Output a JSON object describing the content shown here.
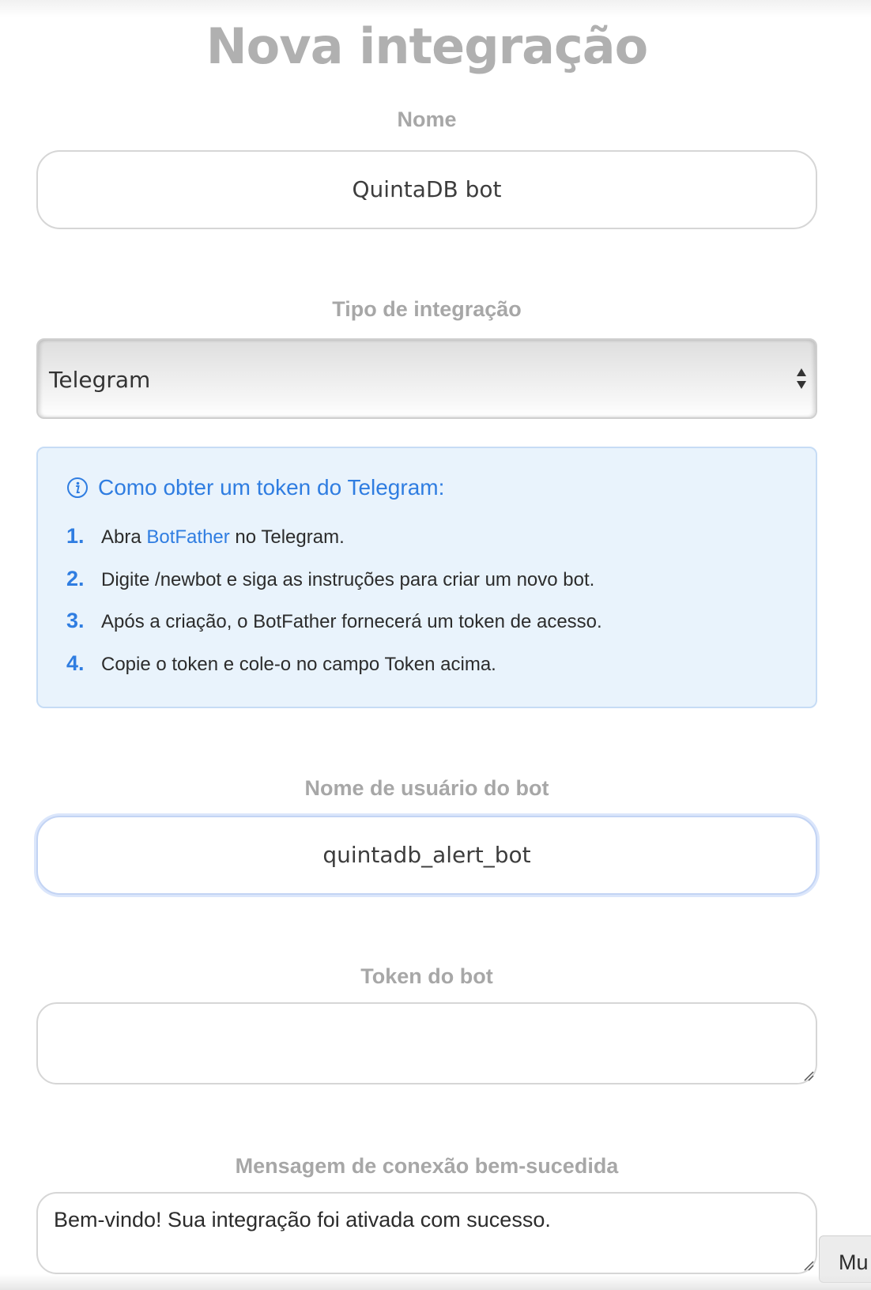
{
  "page": {
    "title": "Nova integração"
  },
  "name_field": {
    "label": "Nome",
    "value": "QuintaDB bot"
  },
  "integration_type": {
    "label": "Tipo de integração",
    "selected": "Telegram"
  },
  "info_box": {
    "title": "Como obter um token do Telegram:",
    "steps": [
      {
        "num": "1.",
        "before": "Abra ",
        "link": "BotFather",
        "after": " no Telegram."
      },
      {
        "num": "2.",
        "text": "Digite /newbot e siga as instruções para criar um novo bot."
      },
      {
        "num": "3.",
        "text": "Após a criação, o BotFather fornecerá um token de acesso."
      },
      {
        "num": "4.",
        "text": "Copie o token e cole-o no campo Token acima."
      }
    ]
  },
  "bot_username": {
    "label": "Nome de usuário do bot",
    "value": "quintadb_alert_bot"
  },
  "bot_token": {
    "label": "Token do bot",
    "value": ""
  },
  "success_message": {
    "label": "Mensagem de conexão bem-sucedida",
    "value": "Bem-vindo! Sua integração foi ativada com sucesso."
  },
  "corner_tab": {
    "label": "Mu"
  },
  "colors": {
    "accent": "#2f7de1",
    "label": "#a7a7a7",
    "info_bg": "#e9f3fc"
  },
  "icons": {
    "info": "info-circle-icon",
    "select": "select-arrows-icon",
    "resize": "resize-grip-icon"
  }
}
